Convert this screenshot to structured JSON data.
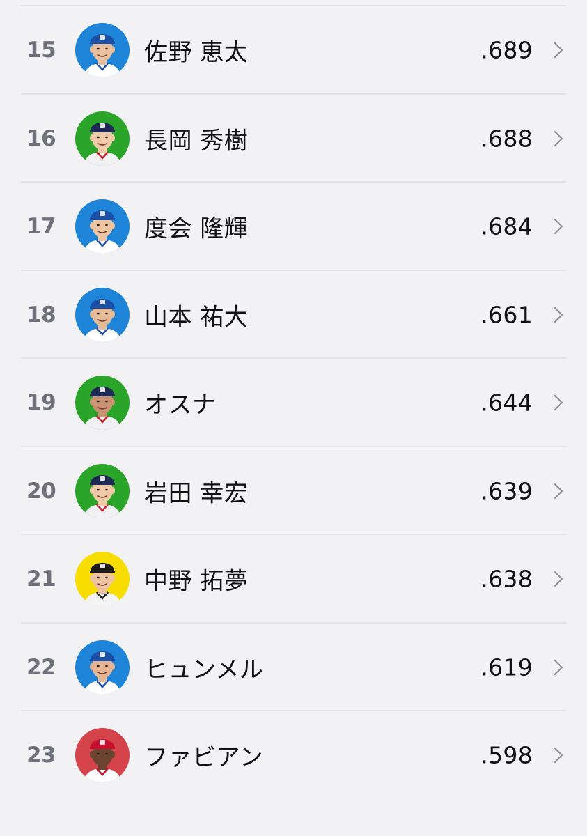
{
  "list": {
    "rows": [
      {
        "rank": "15",
        "name": "佐野 恵太",
        "value": ".689",
        "avatar_bg": "#1d84d7",
        "cap": "#1b4fa8",
        "jersey": "#ffffff",
        "trim": "#1b4fa8",
        "skin": "#e9c09f",
        "hair": "#2b211b"
      },
      {
        "rank": "16",
        "name": "長岡 秀樹",
        "value": ".688",
        "avatar_bg": "#2aa52a",
        "cap": "#1e2a55",
        "jersey": "#f1f1f4",
        "trim": "#cb2230",
        "skin": "#f0caa8",
        "hair": "#2b211b"
      },
      {
        "rank": "17",
        "name": "度会 隆輝",
        "value": ".684",
        "avatar_bg": "#1d84d7",
        "cap": "#1b4fa8",
        "jersey": "#ffffff",
        "trim": "#1b4fa8",
        "skin": "#ecc4a2",
        "hair": "#2b211b"
      },
      {
        "rank": "18",
        "name": "山本 祐大",
        "value": ".661",
        "avatar_bg": "#1d84d7",
        "cap": "#1b4fa8",
        "jersey": "#ffffff",
        "trim": "#1b4fa8",
        "skin": "#e5ba97",
        "hair": "#2b211b"
      },
      {
        "rank": "19",
        "name": "オスナ",
        "value": ".644",
        "avatar_bg": "#2aa52a",
        "cap": "#1e2a55",
        "jersey": "#f1f1f4",
        "trim": "#cb2230",
        "skin": "#c99272",
        "hair": "#2b211b"
      },
      {
        "rank": "20",
        "name": "岩田 幸宏",
        "value": ".639",
        "avatar_bg": "#2aa52a",
        "cap": "#1e2a55",
        "jersey": "#f1f1f4",
        "trim": "#cb2230",
        "skin": "#f0caa8",
        "hair": "#2b211b"
      },
      {
        "rank": "21",
        "name": "中野 拓夢",
        "value": ".638",
        "avatar_bg": "#f7dd00",
        "cap": "#1a1a1a",
        "jersey": "#f4f4f4",
        "trim": "#1a1a1a",
        "skin": "#ecc4a2",
        "hair": "#2b211b"
      },
      {
        "rank": "22",
        "name": "ヒュンメル",
        "value": ".619",
        "avatar_bg": "#1d84d7",
        "cap": "#1b4fa8",
        "jersey": "#ffffff",
        "trim": "#1b4fa8",
        "skin": "#e4b493",
        "hair": "#3a2a20"
      },
      {
        "rank": "23",
        "name": "ファビアン",
        "value": ".598",
        "avatar_bg": "#d4434a",
        "cap": "#c8102e",
        "jersey": "#ffffff",
        "trim": "#c8102e",
        "skin": "#6b4331",
        "hair": "#1c1410"
      }
    ]
  }
}
